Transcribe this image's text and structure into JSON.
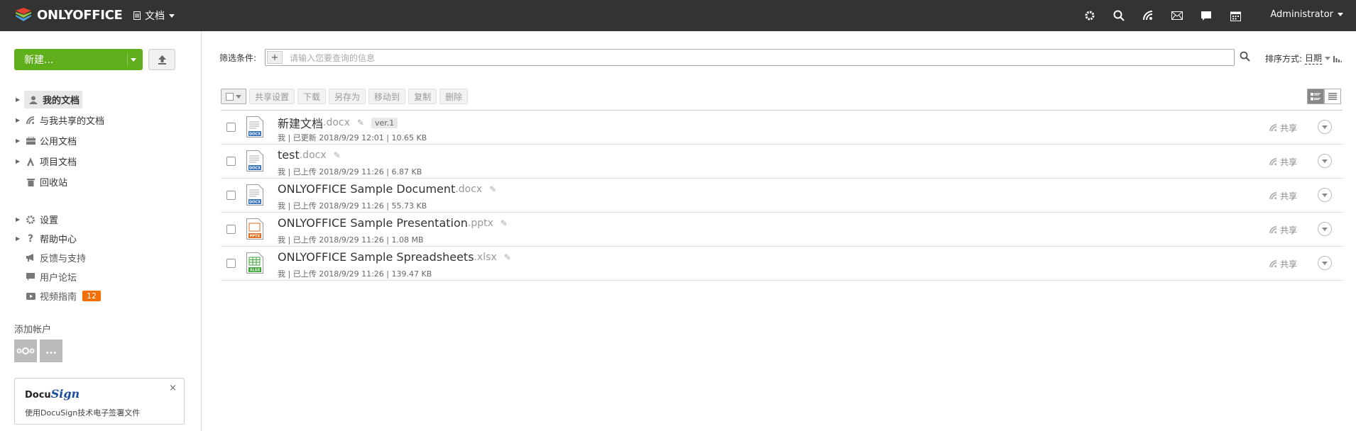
{
  "header": {
    "logo_text": "ONLYOFFICE",
    "module": "文档",
    "user": "Administrator",
    "icons": [
      "settings-icon",
      "search-icon",
      "feed-icon",
      "mail-icon",
      "chat-icon",
      "calendar-icon"
    ]
  },
  "sidebar": {
    "new_button": "新建...",
    "nav": [
      {
        "label": "我的文档",
        "icon": "user-icon",
        "selected": true
      },
      {
        "label": "与我共享的文档",
        "icon": "share-icon"
      },
      {
        "label": "公用文档",
        "icon": "folder-icon"
      },
      {
        "label": "项目文档",
        "icon": "project-icon"
      },
      {
        "label": "回收站",
        "icon": "trash-icon"
      }
    ],
    "nav2": [
      {
        "label": "设置",
        "icon": "gear-icon"
      },
      {
        "label": "帮助中心",
        "icon": "help-icon"
      },
      {
        "label": "反馈与支持",
        "icon": "megaphone-icon"
      },
      {
        "label": "用户论坛",
        "icon": "comment-icon"
      },
      {
        "label": "视频指南",
        "icon": "video-icon",
        "badge": "12"
      }
    ],
    "add_account": "添加帐户",
    "account_more": "...",
    "docusign": {
      "logo_a": "Docu",
      "logo_b": "Sign",
      "text": "使用DocuSign技术电子签署文件",
      "close": "×"
    }
  },
  "filter": {
    "label": "筛选条件:",
    "placeholder": "请输入您要查询的信息",
    "plus": "+",
    "sort_label": "排序方式:",
    "sort_value": "日期"
  },
  "toolbar": {
    "buttons": [
      "共享设置",
      "下载",
      "另存为",
      "移动到",
      "复制",
      "删除"
    ]
  },
  "files": [
    {
      "name": "新建文档",
      "ext": ".docx",
      "ver": "ver.1",
      "meta": "我 | 已更新 2018/9/29 12:01 | 10.65 KB",
      "type": "DOCX",
      "color": "#2d6db5",
      "share": "共享"
    },
    {
      "name": "test",
      "ext": ".docx",
      "meta": "我 | 已上传 2018/9/29 11:26 | 6.87 KB",
      "type": "DOCX",
      "color": "#2d6db5",
      "share": "共享"
    },
    {
      "name": "ONLYOFFICE Sample Document",
      "ext": ".docx",
      "meta": "我 | 已上传 2018/9/29 11:26 | 55.73 KB",
      "type": "DOCX",
      "color": "#2d6db5",
      "share": "共享"
    },
    {
      "name": "ONLYOFFICE Sample Presentation",
      "ext": ".pptx",
      "meta": "我 | 已上传 2018/9/29 11:26 | 1.08 MB",
      "type": "PPTX",
      "color": "#e06a1b",
      "share": "共享"
    },
    {
      "name": "ONLYOFFICE Sample Spreadsheets",
      "ext": ".xlsx",
      "meta": "我 | 已上传 2018/9/29 11:26 | 139.47 KB",
      "type": "XLSX",
      "color": "#3aa535",
      "share": "共享"
    }
  ]
}
